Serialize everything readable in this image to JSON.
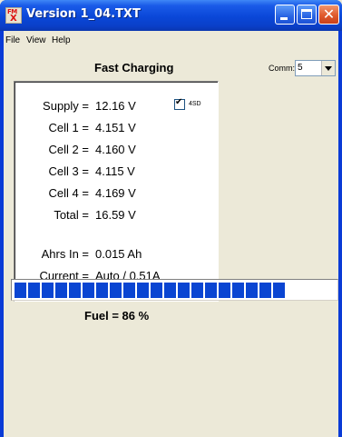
{
  "window": {
    "title": "Version 1_04.TXT",
    "icon": "fm-app-icon",
    "icon_text": "FM",
    "icon_mark": "X",
    "controls": {
      "minimize": "minimize-icon",
      "maximize": "maximize-icon",
      "close": "✕"
    }
  },
  "menu": {
    "file": "File",
    "view": "View",
    "help": "Help"
  },
  "status": {
    "title": "Fast Charging"
  },
  "comm": {
    "label": "Comm:",
    "value": "5"
  },
  "readout": {
    "supply": {
      "label": "Supply =",
      "value": "12.16 V"
    },
    "cell1": {
      "label": "Cell 1 =",
      "value": "4.151 V"
    },
    "cell2": {
      "label": "Cell 2 =",
      "value": "4.160 V"
    },
    "cell3": {
      "label": "Cell 3 =",
      "value": "4.115 V"
    },
    "cell4": {
      "label": "Cell 4 =",
      "value": "4.169 V"
    },
    "total": {
      "label": "Total =",
      "value": "16.59 V"
    },
    "ahrs": {
      "label": "Ahrs In =",
      "value": "0.015 Ah"
    },
    "current": {
      "label": "Current =",
      "value": "Auto / 0.51A"
    }
  },
  "checkbox_4sd": {
    "label": "4SD",
    "checked": true,
    "check_glyph": "✔"
  },
  "fuel": {
    "percent": 86,
    "text": "Fuel = 86 %",
    "bar_color": "#0a45d2"
  }
}
